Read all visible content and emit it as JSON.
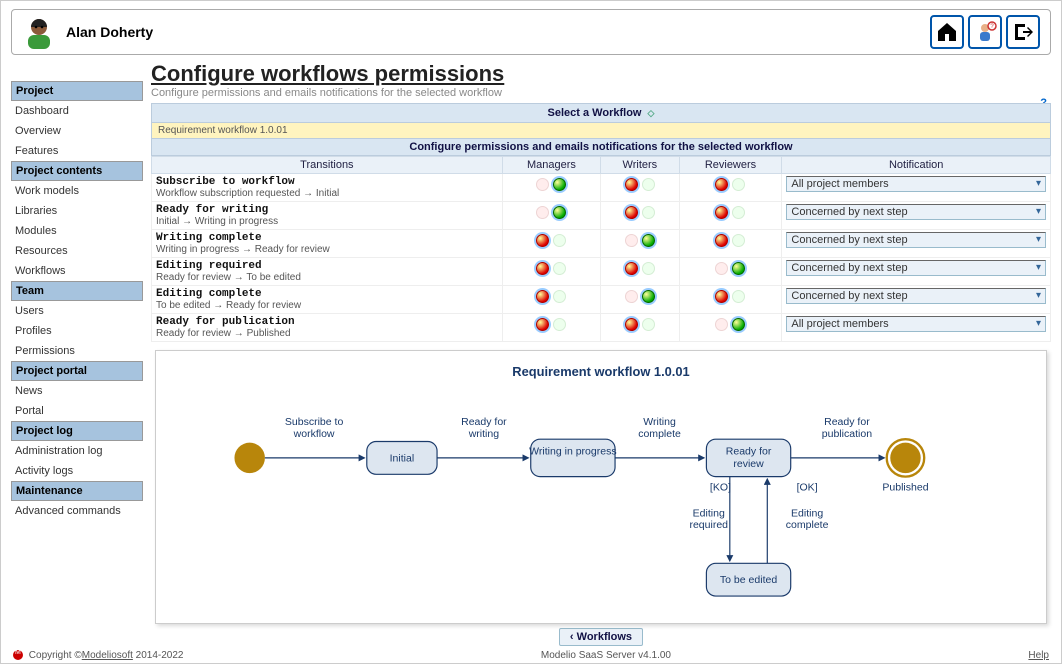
{
  "user": {
    "name": "Alan Doherty"
  },
  "header_icons": {
    "home": "home-icon",
    "support": "support-icon",
    "logout": "logout-icon"
  },
  "sidebar": [
    {
      "header": "Project",
      "items": [
        "Dashboard",
        "Overview",
        "Features"
      ]
    },
    {
      "header": "Project contents",
      "items": [
        "Work models",
        "Libraries",
        "Modules",
        "Resources",
        "Workflows"
      ]
    },
    {
      "header": "Team",
      "items": [
        "Users",
        "Profiles",
        "Permissions"
      ]
    },
    {
      "header": "Project portal",
      "items": [
        "News",
        "Portal"
      ]
    },
    {
      "header": "Project log",
      "items": [
        "Administration log",
        "Activity logs"
      ]
    },
    {
      "header": "Maintenance",
      "items": [
        "Advanced commands"
      ]
    }
  ],
  "page": {
    "title": "Configure workflows permissions",
    "subtitle": "Configure permissions and emails notifications for the selected workflow",
    "help": "?"
  },
  "workflow_selector": {
    "label": "Select a Workflow",
    "selected": "Requirement workflow 1.0.01"
  },
  "table": {
    "caption": "Configure permissions and emails notifications for the selected workflow",
    "columns": [
      "Transitions",
      "Managers",
      "Writers",
      "Reviewers",
      "Notification"
    ],
    "rows": [
      {
        "name": "Subscribe to workflow",
        "desc": "Workflow subscription requested → Initial",
        "managers": [
          "red-off",
          "grn-on sel"
        ],
        "writers": [
          "red-on sel",
          "grn-off"
        ],
        "reviewers": [
          "red-on sel",
          "grn-off"
        ],
        "notif": "All project members"
      },
      {
        "name": "Ready for writing",
        "desc": "Initial → Writing in progress",
        "managers": [
          "red-off",
          "grn-on sel"
        ],
        "writers": [
          "red-on sel",
          "grn-off"
        ],
        "reviewers": [
          "red-on sel",
          "grn-off"
        ],
        "notif": "Concerned by next step"
      },
      {
        "name": "Writing complete",
        "desc": "Writing in progress → Ready for review",
        "managers": [
          "red-on sel",
          "grn-off"
        ],
        "writers": [
          "red-off",
          "grn-on sel"
        ],
        "reviewers": [
          "red-on sel",
          "grn-off"
        ],
        "notif": "Concerned by next step"
      },
      {
        "name": "Editing required",
        "desc": "Ready for review → To be edited",
        "managers": [
          "red-on sel",
          "grn-off"
        ],
        "writers": [
          "red-on sel",
          "grn-off"
        ],
        "reviewers": [
          "red-off",
          "grn-on sel"
        ],
        "notif": "Concerned by next step"
      },
      {
        "name": "Editing complete",
        "desc": "To be edited → Ready for review",
        "managers": [
          "red-on sel",
          "grn-off"
        ],
        "writers": [
          "red-off",
          "grn-on sel"
        ],
        "reviewers": [
          "red-on sel",
          "grn-off"
        ],
        "notif": "Concerned by next step"
      },
      {
        "name": "Ready for publication",
        "desc": "Ready for review → Published",
        "managers": [
          "red-on sel",
          "grn-off"
        ],
        "writers": [
          "red-on sel",
          "grn-off"
        ],
        "reviewers": [
          "red-off",
          "grn-on sel"
        ],
        "notif": "All project members"
      }
    ]
  },
  "diagram": {
    "title": "Requirement workflow 1.0.01",
    "nodes": {
      "initial": "Initial",
      "wip": "Writing in progress",
      "rfr": "Ready for review",
      "tbe": "To be edited",
      "pub": "Published"
    },
    "edges": {
      "sub": "Subscribe to workflow",
      "rfw": "Ready for writing",
      "wc": "Writing complete",
      "rfp": "Ready for publication",
      "ko": "[KO]",
      "ok": "[OK]",
      "er": "Editing required",
      "ec": "Editing complete"
    }
  },
  "back_button": "‹  Workflows",
  "footer": {
    "copyright_prefix": "Copyright ©",
    "copyright_link": "Modeliosoft",
    "copyright_suffix": " 2014-2022",
    "center": "Modelio SaaS Server v4.1.00",
    "help": "Help"
  }
}
